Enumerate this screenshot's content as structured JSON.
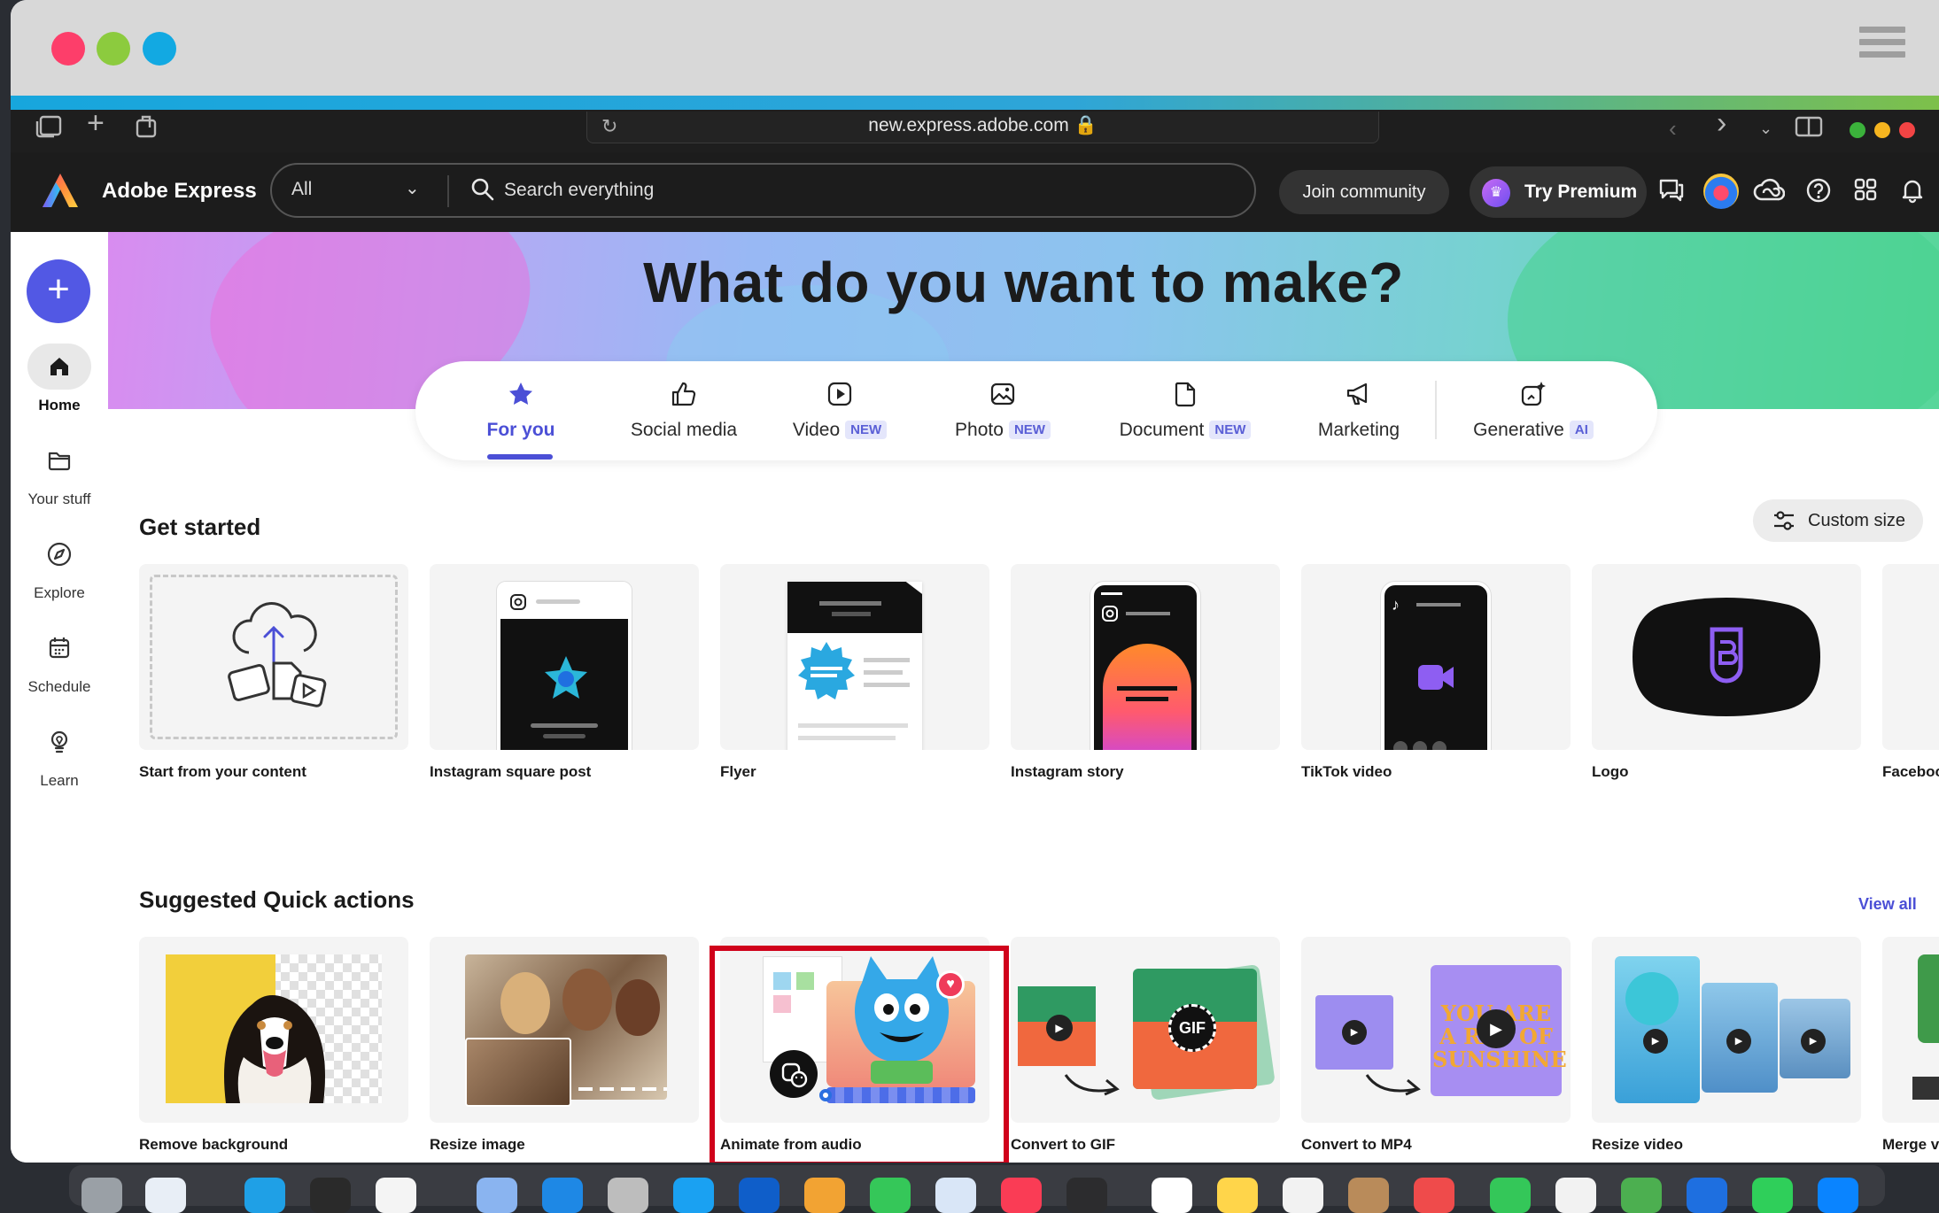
{
  "browser": {
    "url": "new.express.adobe.com"
  },
  "header": {
    "brand": "Adobe Express",
    "search_category": "All",
    "search_placeholder": "Search everything",
    "join_label": "Join community",
    "premium_label": "Try Premium"
  },
  "sidebar": {
    "items": [
      {
        "label": "Home",
        "icon": "home-icon"
      },
      {
        "label": "Your stuff",
        "icon": "folder-icon"
      },
      {
        "label": "Explore",
        "icon": "compass-icon"
      },
      {
        "label": "Schedule",
        "icon": "calendar-icon"
      },
      {
        "label": "Learn",
        "icon": "lightbulb-icon"
      }
    ]
  },
  "hero": {
    "title": "What do you want to make?"
  },
  "tabs": [
    {
      "label": "For you",
      "badge": ""
    },
    {
      "label": "Social media",
      "badge": ""
    },
    {
      "label": "Video",
      "badge": "NEW"
    },
    {
      "label": "Photo",
      "badge": "NEW"
    },
    {
      "label": "Document",
      "badge": "NEW"
    },
    {
      "label": "Marketing",
      "badge": ""
    },
    {
      "label": "Generative",
      "badge": "AI"
    }
  ],
  "get_started": {
    "title": "Get started",
    "custom_size_label": "Custom size",
    "cards": [
      {
        "label": "Start from your content"
      },
      {
        "label": "Instagram square post"
      },
      {
        "label": "Flyer"
      },
      {
        "label": "Instagram story"
      },
      {
        "label": "TikTok video"
      },
      {
        "label": "Logo"
      },
      {
        "label": "Faceboo"
      }
    ]
  },
  "quick_actions": {
    "title": "Suggested Quick actions",
    "view_all": "View all",
    "cards": [
      {
        "label": "Remove background"
      },
      {
        "label": "Resize image"
      },
      {
        "label": "Animate from audio"
      },
      {
        "label": "Convert to GIF"
      },
      {
        "label": "Convert to MP4"
      },
      {
        "label": "Resize video"
      },
      {
        "label": "Merge vi"
      }
    ],
    "gif_badge": "GIF",
    "mp4_text": "YOU ARE A RAY OF SUNSHINE"
  },
  "colors": {
    "accent": "#4b4fd6",
    "highlight": "#d0021b",
    "header_bg": "#1c1c1c"
  }
}
